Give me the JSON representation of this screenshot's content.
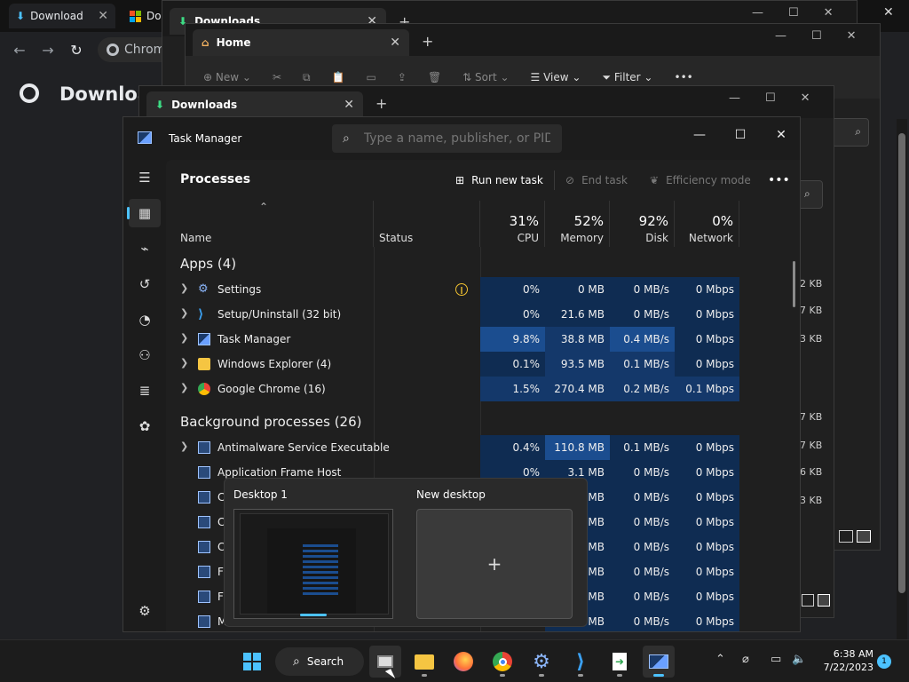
{
  "chrome": {
    "tabs": [
      "Download",
      "Do"
    ],
    "omnibox": "Chrom",
    "page_title": "Download"
  },
  "explorer_back": {
    "tab": "Downloads"
  },
  "explorer_home": {
    "tab": "Home",
    "toolbar": [
      "New",
      "Sort",
      "View",
      "Filter"
    ]
  },
  "explorer_front": {
    "tab": "Downloads"
  },
  "right_sizes": [
    "2 KB",
    "7 KB",
    "3 KB",
    "7 KB",
    "7 KB",
    "6 KB",
    "3 KB"
  ],
  "taskmanager": {
    "title": "Task Manager",
    "search_placeholder": "Type a name, publisher, or PID...",
    "page": "Processes",
    "actions": {
      "run": "Run new task",
      "end": "End task",
      "efficiency": "Efficiency mode"
    },
    "columns": {
      "name": "Name",
      "status": "Status",
      "cpu_pct": "31%",
      "cpu": "CPU",
      "mem_pct": "52%",
      "mem": "Memory",
      "disk_pct": "92%",
      "disk": "Disk",
      "net_pct": "0%",
      "net": "Network"
    },
    "apps_header": "Apps (4)",
    "bg_header": "Background processes (26)",
    "apps": [
      {
        "name": "Settings",
        "cpu": "0%",
        "mem": "0 MB",
        "disk": "0 MB/s",
        "net": "0 Mbps"
      },
      {
        "name": "Setup/Uninstall (32 bit)",
        "cpu": "0%",
        "mem": "21.6 MB",
        "disk": "0 MB/s",
        "net": "0 Mbps"
      },
      {
        "name": "Task Manager",
        "cpu": "9.8%",
        "mem": "38.8 MB",
        "disk": "0.4 MB/s",
        "net": "0 Mbps"
      },
      {
        "name": "Windows Explorer (4)",
        "cpu": "0.1%",
        "mem": "93.5 MB",
        "disk": "0.1 MB/s",
        "net": "0 Mbps"
      },
      {
        "name": "Google Chrome (16)",
        "cpu": "1.5%",
        "mem": "270.4 MB",
        "disk": "0.2 MB/s",
        "net": "0.1 Mbps"
      }
    ],
    "bg": [
      {
        "name": "Antimalware Service Executable",
        "cpu": "0.4%",
        "mem": "110.8 MB",
        "disk": "0.1 MB/s",
        "net": "0 Mbps"
      },
      {
        "name": "Application Frame Host",
        "cpu": "0%",
        "mem": "3.1 MB",
        "disk": "0 MB/s",
        "net": "0 Mbps"
      },
      {
        "name": "C",
        "mem": "MB",
        "disk": "0 MB/s",
        "net": "0 Mbps"
      },
      {
        "name": "C",
        "mem": "MB",
        "disk": "0 MB/s",
        "net": "0 Mbps"
      },
      {
        "name": "C",
        "mem": "MB",
        "disk": "0 MB/s",
        "net": "0 Mbps"
      },
      {
        "name": "F",
        "mem": "MB",
        "disk": "0 MB/s",
        "net": "0 Mbps"
      },
      {
        "name": "F",
        "mem": "MB",
        "disk": "0 MB/s",
        "net": "0 Mbps"
      },
      {
        "name": "M",
        "mem": "MB",
        "disk": "0 MB/s",
        "net": "0 Mbps"
      }
    ]
  },
  "desktops": {
    "d1": "Desktop 1",
    "new": "New desktop"
  },
  "taskbar": {
    "search": "Search",
    "time": "6:38 AM",
    "date": "7/22/2023",
    "notifications": "1"
  }
}
